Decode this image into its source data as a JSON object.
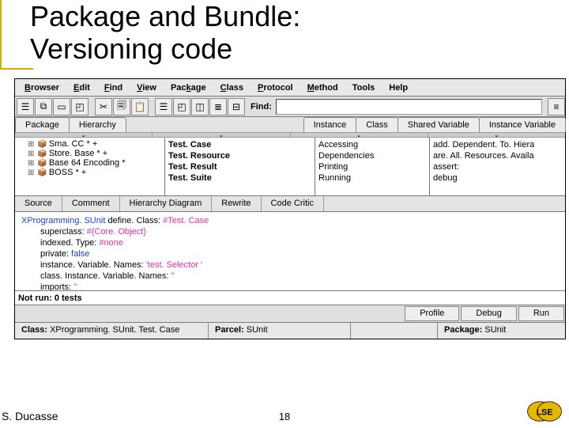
{
  "slide": {
    "title_line1": "Package and Bundle:",
    "title_line2": "Versioning code"
  },
  "menu": {
    "browser": "Browser",
    "edit": "Edit",
    "find": "Find",
    "view": "View",
    "package": "Package",
    "class": "Class",
    "protocol": "Protocol",
    "method": "Method",
    "tools": "Tools",
    "help": "Help"
  },
  "find_label": "Find:",
  "top_tabs": {
    "package": "Package",
    "hierarchy": "Hierarchy",
    "instance": "Instance",
    "class": "Class",
    "sharedvar": "Shared Variable",
    "instvar": "Instance Variable"
  },
  "packages": [
    "Sma. CC * +",
    "Store. Base * +",
    "Base 64 Encoding *",
    "BOSS * +"
  ],
  "classes": [
    "Test. Case",
    "Test. Resource",
    "Test. Result",
    "Test. Suite"
  ],
  "protocols": [
    "Accessing",
    "Dependencies",
    "Printing",
    "Running"
  ],
  "methods": [
    "add. Dependent. To. Hiera",
    "are. All. Resources. Availa",
    "assert:",
    "debug"
  ],
  "mid_tabs": {
    "source": "Source",
    "comment": "Comment",
    "hierdiag": "Hierarchy Diagram",
    "rewrite": "Rewrite",
    "critic": "Code Critic"
  },
  "code": {
    "l0a": "XProgramming. SUnit ",
    "l0b": "define. Class: ",
    "l0c": "#Test. Case",
    "l1a": "superclass: ",
    "l1b": "#{Core. Object}",
    "l2a": "indexed. Type: ",
    "l2b": "#none",
    "l3a": "private: ",
    "l3b": "false",
    "l4a": "instance. Variable. Names: ",
    "l4b": "'test. Selector '",
    "l5a": "class. Instance. Variable. Names: ",
    "l5b": "''",
    "l6a": "imports: ",
    "l6b": "''"
  },
  "status": "Not run: 0 tests",
  "buttons": {
    "profile": "Profile",
    "debug": "Debug",
    "run": "Run"
  },
  "footer": {
    "class_l": "Class: ",
    "class_v": "XProgramming. SUnit. Test. Case",
    "parcel_l": "Parcel: ",
    "parcel_v": "SUnit",
    "pkg_l": "Package: ",
    "pkg_v": "SUnit"
  },
  "author": "S. Ducasse",
  "pagenum": "18",
  "logo_text": "LSE"
}
